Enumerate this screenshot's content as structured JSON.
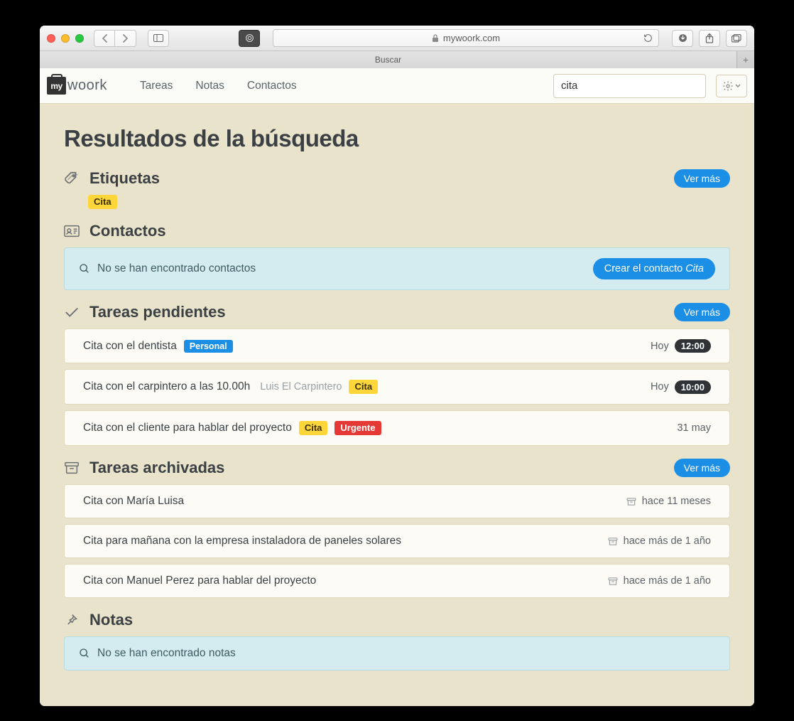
{
  "browser": {
    "url_label": "mywoork.com",
    "tab_title": "Buscar"
  },
  "app": {
    "logo_text": "my",
    "brand": "woork",
    "nav": {
      "tareas": "Tareas",
      "notas": "Notas",
      "contactos": "Contactos"
    },
    "search_value": "cita"
  },
  "page_title": "Resultados de la búsqueda",
  "ver_mas": "Ver más",
  "etiquetas": {
    "heading": "Etiquetas",
    "tag": "Cita"
  },
  "contactos": {
    "heading": "Contactos",
    "empty_msg": "No se han encontrado contactos",
    "create_prefix": "Crear el contacto ",
    "create_name": "Cita"
  },
  "pendientes": {
    "heading": "Tareas pendientes",
    "rows": [
      {
        "title": "Cita con el dentista",
        "tag_blue": "Personal",
        "date": "Hoy",
        "time": "12:00"
      },
      {
        "title": "Cita con el carpintero a las 10.00h",
        "extra": "Luis El Carpintero",
        "tag_yellow": "Cita",
        "date": "Hoy",
        "time": "10:00"
      },
      {
        "title": "Cita con el cliente para hablar del proyecto",
        "tag_yellow": "Cita",
        "tag_red": "Urgente",
        "date": "31 may"
      }
    ]
  },
  "archivadas": {
    "heading": "Tareas archivadas",
    "rows": [
      {
        "title": "Cita con María Luisa",
        "when": "hace 11 meses"
      },
      {
        "title": "Cita para mañana con la empresa instaladora de paneles solares",
        "when": "hace más de 1 año"
      },
      {
        "title": "Cita con Manuel Perez para hablar del proyecto",
        "when": "hace más de 1 año"
      }
    ]
  },
  "notas": {
    "heading": "Notas",
    "empty_msg": "No se han encontrado notas"
  }
}
